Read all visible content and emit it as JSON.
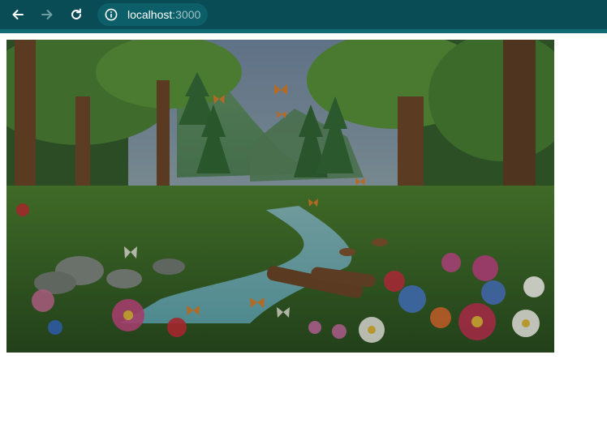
{
  "browser": {
    "url_host": "localhost",
    "url_port": ":3000",
    "icons": {
      "back": "arrow-left-icon",
      "forward": "arrow-right-icon",
      "reload": "reload-icon",
      "site_info": "info-icon"
    },
    "colors": {
      "toolbar": "#0a4c55",
      "accent": "#0f6a73",
      "omnibox": "#0c5f68"
    }
  },
  "page": {
    "image": {
      "subject": "forest-scene-illustration"
    }
  }
}
